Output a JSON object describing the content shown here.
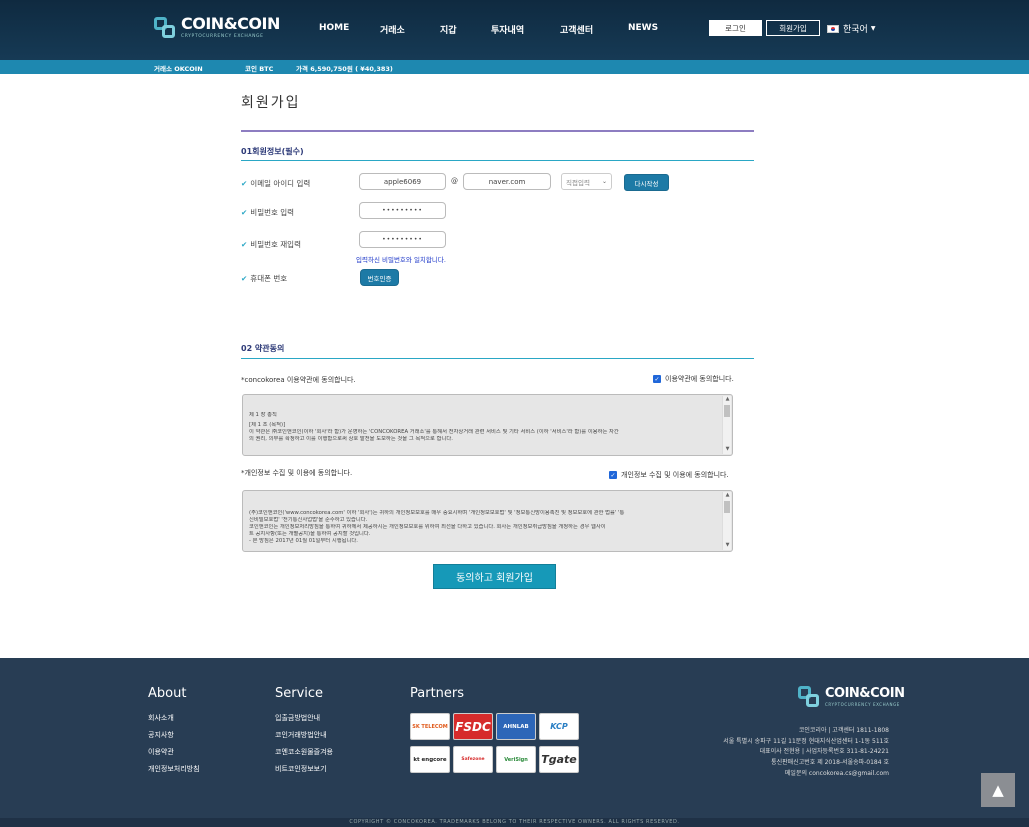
{
  "header": {
    "brand": "COIN&COIN",
    "brand_sub": "CRYPTOCURRENCY EXCHANGE",
    "nav": [
      "HOME",
      "거래소",
      "지갑",
      "투자내역",
      "고객센터",
      "NEWS"
    ],
    "login": "로그인",
    "signup": "회원가입",
    "language": "한국어"
  },
  "ticker": {
    "exchange": "거래소 OKCOIN",
    "coin": "코인 BTC",
    "price": "가격  6,590,750원 ( ¥40,383)"
  },
  "page": {
    "title": "회원가입"
  },
  "section1": {
    "title": "01회원정보(필수)",
    "email_label": "이메일 아이디 입력",
    "email_id": "apple6069",
    "at": "@",
    "email_domain": "naver.com",
    "domain_select": "직접입력",
    "rewrite": "다시작성",
    "pw_label": "비밀번호 입력",
    "pw_value": "•••••••••",
    "pw2_label": "비밀번호 재입력",
    "pw2_value": "•••••••••",
    "pw_error": "입력하신 비밀번호와 일치합니다.",
    "phone_label": "휴대폰 번호",
    "verify": "번호인증"
  },
  "section2": {
    "title": "02 약관동의",
    "terms_label": "*concokorea 이용약관에 동의합니다.",
    "terms_check": "이용약관에 동의합니다.",
    "terms_text": [
      "제 1 장 총칙",
      "[제 1 조 (목적)]",
      "이 약관은 ㈜코인앤코인(이하 '회사'라 함)가 운영하는 'CONCOKOREA 거래소'를 통해서 전자상거래 관련 서비스 및 기타 서비스 (이하 '서비스'라 함)를 이용하는 자간",
      "의 권리, 의무를 확정하고 이를 이행함으로써 상호 발전을 도모하는 것을 그 목적으로 합니다."
    ],
    "privacy_label": "*개인정보 수집 및 이용에 동의합니다.",
    "privacy_check": "개인정보 수집 및 이용에 동의합니다.",
    "privacy_text": [
      "(주)코인앤코인('www.concokorea.com' 이하 '회사')는 귀하의 개인정보보호를 매우 중요시하며 '개인정보보호법' 및 '정보통신망이용촉진 및 정보보호에 관한 법률' '통",
      "신비밀보호법' '전기통신사업법'을 준수하고 있습니다.",
      "코인앤코인는 개인정보처리방침을 통하여 귀하께서 제공하시는 개인정보보호를 위하여 최선을 다하고 있습니다. 회사는 개인정보취급방침을 개정하는 경우 웹사이",
      "트 공지사항(또는 개별공지)을 통하여 공지할 것입니다.",
      "- 본 방침은 2017년 01월 01일부터 시행됩니다."
    ],
    "submit": "동의하고 회원가입"
  },
  "footer": {
    "about": {
      "title": "About",
      "links": [
        "회사소개",
        "공지사항",
        "이용약관",
        "개인정보처리방침"
      ]
    },
    "service": {
      "title": "Service",
      "links": [
        "입출금방법안내",
        "코인거래방법안내",
        "코엔코소원물즐겨용",
        "비트코인정보보기"
      ]
    },
    "partners": {
      "title": "Partners",
      "items": [
        "SK TELECOM",
        "FSDC",
        "AHNLAB",
        "KCP",
        "kt engcore",
        "Safezone",
        "VeriSign",
        "Tgate"
      ]
    },
    "brand": "COIN&COIN",
    "brand_sub": "CRYPTOCURRENCY EXCHANGE",
    "info": [
      "코인코리아 | 고객센터 1811-1808",
      "서울 특별시 송파구 11길 11문정 현대지식산업센터 1-1동 511호",
      "대표이사 전현용 | 사업자등록번호 311-81-24221",
      "통신판매신고번호 제 2018-서울송파-0184 호",
      "메일문의 concokorea.cs@gmail.com"
    ],
    "copyright": "COPYRIGHT © CONCOKOREA. TRADEMARKS BELONG TO THEIR RESPECTIVE OWNERS. ALL RIGHTS RESERVED.",
    "top_icon": "arrow-up-icon"
  }
}
